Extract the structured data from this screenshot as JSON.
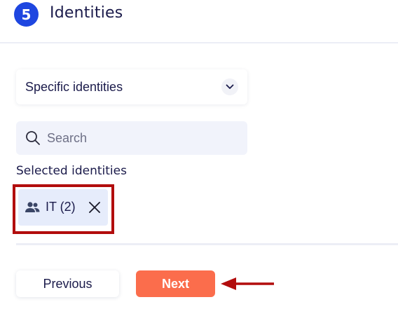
{
  "header": {
    "step_number": "5",
    "title": "Identities"
  },
  "scope_dropdown": {
    "selected_value": "Specific identities",
    "icon": "chevron-down-icon"
  },
  "search": {
    "placeholder": "Search",
    "value": "",
    "icon": "search-icon"
  },
  "selected_identities": {
    "label": "Selected identities",
    "items": [
      {
        "label": "IT (2)",
        "icon": "group-icon",
        "remove_icon": "close-icon"
      }
    ]
  },
  "footer": {
    "previous_label": "Previous",
    "next_label": "Next"
  },
  "annotations": {
    "highlight_color": "#b20d0d",
    "arrow_color": "#b20d0d"
  },
  "colors": {
    "step_badge": "#1e46e0",
    "next_button": "#fb6d4c",
    "chip_background": "#e6ecfb",
    "text": "#1b1b4b"
  }
}
